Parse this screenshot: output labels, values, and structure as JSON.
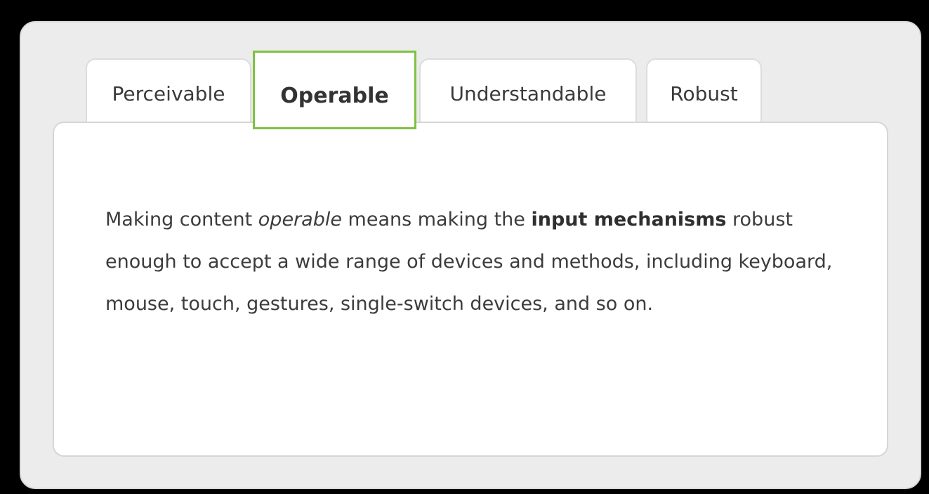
{
  "tabs": [
    {
      "label": "Perceivable",
      "selected": false
    },
    {
      "label": "Operable",
      "selected": true
    },
    {
      "label": "Understandable",
      "selected": false
    },
    {
      "label": "Robust",
      "selected": false
    }
  ],
  "content": {
    "part1": "Making content ",
    "emphasis": "operable",
    "part2": " means making the ",
    "strong": "input mechanisms",
    "part3": " robust enough to accept a wide range of devices and methods, including keyboard, mouse, touch, gestures, single-switch devices, and so on."
  },
  "colors": {
    "selected_tab_outline": "#7ec242",
    "panel_background": "#ececec",
    "content_background": "#ffffff",
    "page_background": "#000000"
  }
}
